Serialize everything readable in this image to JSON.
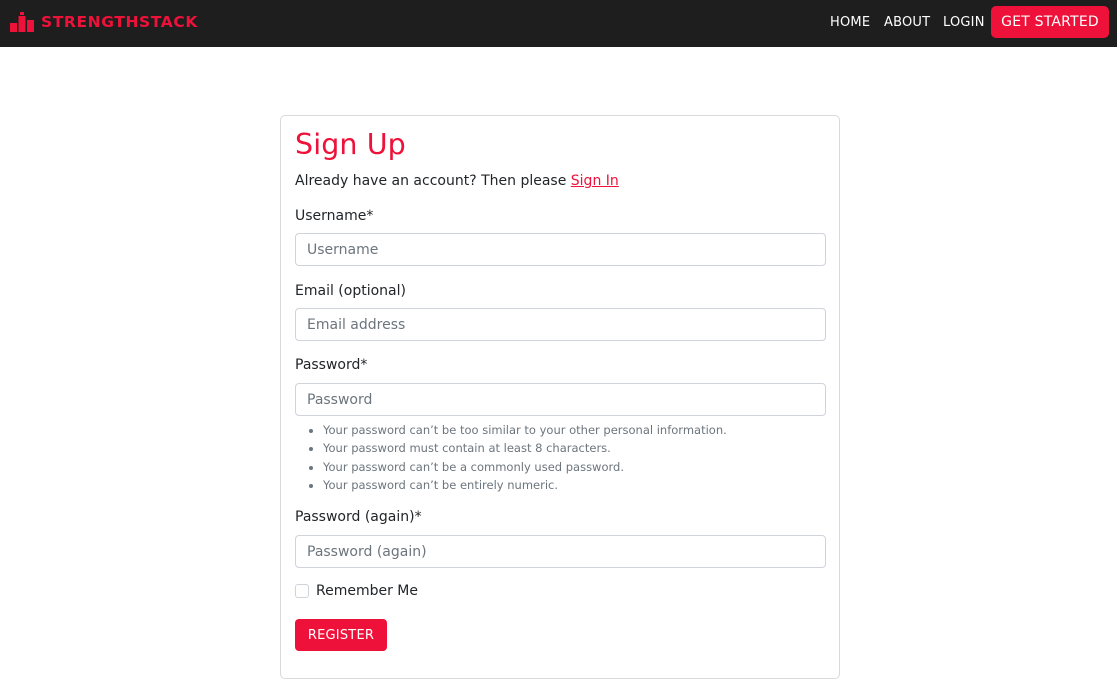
{
  "navbar": {
    "brand": "STRENGTHSTACK",
    "brand_icon": "podium-icon",
    "links": [
      {
        "label": "HOME"
      },
      {
        "label": "ABOUT"
      },
      {
        "label": "LOGIN"
      }
    ],
    "cta_label": "GET STARTED"
  },
  "form": {
    "title": "Sign Up",
    "subtitle_prefix": "Already have an account? Then please ",
    "signin_link": "Sign In",
    "username_label": "Username*",
    "username_placeholder": "Username",
    "email_label": "Email (optional)",
    "email_placeholder": "Email address",
    "password_label": "Password*",
    "password_placeholder": "Password",
    "password_help": [
      "Your password can’t be too similar to your other personal information.",
      "Your password must contain at least 8 characters.",
      "Your password can’t be a commonly used password.",
      "Your password can’t be entirely numeric."
    ],
    "password2_label": "Password (again)*",
    "password2_placeholder": "Password (again)",
    "remember_label": "Remember Me",
    "register_label": "REGISTER"
  },
  "colors": {
    "accent": "#ee1139",
    "navbar_bg": "#1f1e1e"
  }
}
